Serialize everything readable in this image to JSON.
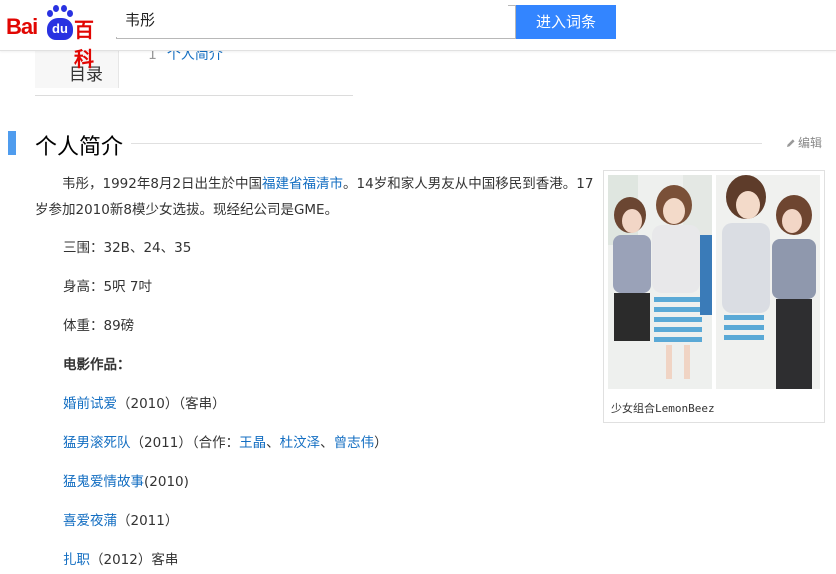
{
  "header": {
    "logo_bai": "Bai",
    "logo_du": "du",
    "logo_baike": "百科",
    "search_value": "韦彤",
    "search_button": "进入词条"
  },
  "toc": {
    "title": "目录",
    "items": [
      {
        "num": "1",
        "label": "个人简介"
      }
    ]
  },
  "section": {
    "title": "个人简介",
    "edit_label": "编辑"
  },
  "intro": {
    "t1": "韦彤，1992年8月2日出生於中国",
    "link1": "福建省",
    "link2": "福清市",
    "t2": "。14岁和家人男友从中国移民到香港。17岁参加2010新8模少女选拔。现经纪公司是GME。"
  },
  "facts": [
    "三围：32B、24、35",
    "身高：5呎 7吋",
    "体重：89磅"
  ],
  "films": {
    "heading": "电影作品：",
    "items": [
      {
        "link": "婚前试爱",
        "rest": "（2010）（客串）"
      },
      {
        "link": "猛男滚死队",
        "rest": "（2011）（合作：",
        "cast": [
          "王晶",
          "杜汶泽",
          "曾志伟"
        ],
        "sep": "、",
        "end": "）"
      },
      {
        "link": "猛鬼爱情故事",
        "rest": "(2010)"
      },
      {
        "link": "喜爱夜蒲",
        "rest": "（2011）"
      },
      {
        "link": "扎职",
        "rest": "（2012）客串"
      }
    ]
  },
  "image": {
    "caption": "少女组合LemonBeez"
  },
  "colors": {
    "brand_red": "#e10602",
    "brand_blue": "#2932e1",
    "button_blue": "#3385ff",
    "link_blue": "#136ec2",
    "section_bar": "#4f9cee"
  }
}
